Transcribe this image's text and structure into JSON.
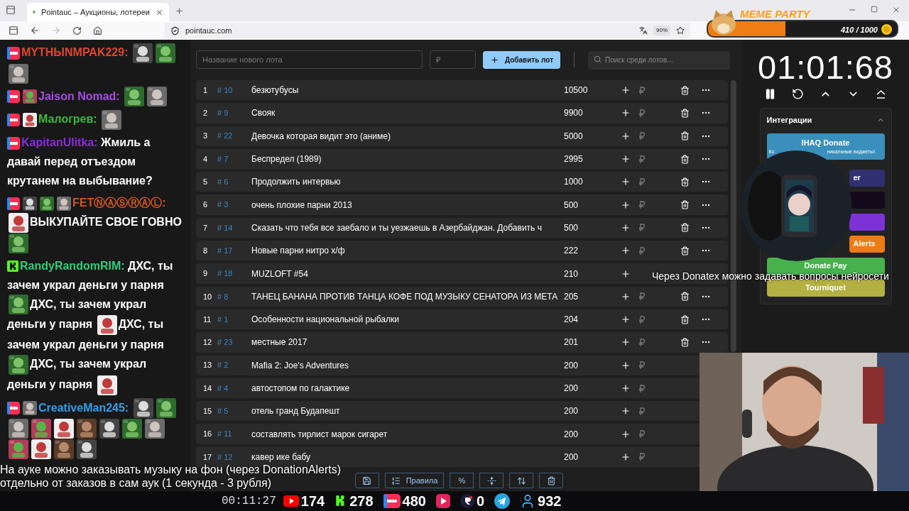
{
  "browser": {
    "tab_title": "Pointauc – Аукционы, лотереи",
    "url": "pointauc.com",
    "zoom": "90%"
  },
  "meme_widget": {
    "title": "MEME PARTY",
    "progress": "410 / 1000",
    "level": 0.41
  },
  "chat": [
    {
      "kind": "live",
      "user": "MYTHЫNMPAK229:",
      "color": "#e0452a",
      "content": [
        {
          "kind": "picture"
        },
        {
          "kind": "picture"
        },
        {
          "kind": "picture"
        }
      ]
    },
    {
      "kind": "live",
      "badges": [
        {
          "kind": "picture"
        }
      ],
      "user": "Jaison Nomad:",
      "color": "#a64de6",
      "content": [
        {
          "kind": "picture"
        },
        {
          "kind": "picture"
        }
      ]
    },
    {
      "kind": "live",
      "badges": [
        {
          "kind": "picture"
        }
      ],
      "user": "Малогрев:",
      "color": "#3cb83c",
      "content": [
        {
          "kind": "picture"
        }
      ]
    },
    {
      "kind": "live",
      "user": "KapitanUlitka:",
      "color": "#8a2be2",
      "content": [
        {
          "kind": "text",
          "text": "**Жмиль** а"
        },
        {
          "kind": "text",
          "text": "давай перед отъездом"
        },
        {
          "kind": "text",
          "text": "крутанем на выбывание?"
        }
      ]
    },
    {
      "kind": "live",
      "badges": [
        {
          "kind": "picture"
        },
        {
          "kind": "picture"
        },
        {
          "kind": "picture"
        }
      ],
      "user": "FETⓃⒶⓈⓇⒶⓁ:",
      "color": "#d2551e",
      "content": [
        {
          "kind": "picture"
        },
        {
          "kind": "text",
          "text": "ВЫКУПАЙТЕ СВОЕ"
        },
        {
          "kind": "text",
          "text": "ГОВНО"
        },
        {
          "kind": "picture"
        }
      ]
    },
    {
      "kind": "kick",
      "user": "RandyRandomRIM:",
      "color": "#2fcf7a",
      "content": [
        {
          "kind": "text",
          "text": "ДХС, ты"
        },
        {
          "kind": "text",
          "text": "зачем украл деньги у парня"
        },
        {
          "kind": "picture"
        },
        {
          "kind": "text",
          "text": "ДХС, ты зачем украл"
        },
        {
          "kind": "text",
          "text": "деньги у парня"
        },
        {
          "kind": "picture"
        },
        {
          "kind": "text",
          "text": "ДХС, ты"
        },
        {
          "kind": "text",
          "text": "зачем украл деньги у парня"
        },
        {
          "kind": "picture"
        },
        {
          "kind": "text",
          "text": "ДХС, ты зачем украл"
        },
        {
          "kind": "text",
          "text": "деньги у парня"
        },
        {
          "kind": "picture"
        }
      ]
    },
    {
      "kind": "live",
      "badges": [
        {
          "kind": "picture"
        }
      ],
      "user": "CreativeMan245:",
      "color": "#2f9ee8",
      "content": [
        {
          "kind": "picture"
        },
        {
          "kind": "picture"
        },
        {
          "kind": "picture"
        },
        {
          "kind": "picture"
        },
        {
          "kind": "picture"
        },
        {
          "kind": "picture"
        },
        {
          "kind": "picture"
        },
        {
          "kind": "picture"
        },
        {
          "kind": "picture"
        },
        {
          "kind": "picture"
        },
        {
          "kind": "picture"
        },
        {
          "kind": "picture"
        },
        {
          "kind": "picture"
        }
      ]
    }
  ],
  "auction": {
    "name_placeholder": "Название нового лота",
    "amount_placeholder": "₽",
    "add_button": "Добавить лот",
    "search_placeholder": "Поиск среди лотов...",
    "lots": [
      {
        "n": "1",
        "id": "# 10",
        "name": "безютубусы",
        "amount": "10500",
        "kind": "full"
      },
      {
        "n": "2",
        "id": "# 9",
        "name": "Свояк",
        "amount": "9900",
        "kind": "full"
      },
      {
        "n": "3",
        "id": "# 22",
        "name": "Девочка которая видит это (аниме)",
        "amount": "5000",
        "kind": "full"
      },
      {
        "n": "4",
        "id": "# 7",
        "name": "Беспредел (1989)",
        "amount": "2995",
        "kind": "full"
      },
      {
        "n": "5",
        "id": "# 6",
        "name": "Продолжить интервью",
        "amount": "1000",
        "kind": "full"
      },
      {
        "n": "6",
        "id": "# 3",
        "name": "очень плохие парни 2013",
        "amount": "500",
        "kind": "full"
      },
      {
        "n": "7",
        "id": "# 14",
        "name": "Сказать что тебя все заебало и ты уезжаешь в Азербайджан. Добавить ч",
        "amount": "500",
        "kind": "full"
      },
      {
        "n": "8",
        "id": "# 17",
        "name": "Новые парни нитро х/ф",
        "amount": "222",
        "kind": "full"
      },
      {
        "n": "9",
        "id": "# 18",
        "name": "MUZLOFT #54",
        "amount": "210",
        "kind": "covered"
      },
      {
        "n": "10",
        "id": "# 8",
        "name": "ТАНЕЦ БАНАНА ПРОТИВ ТАНЦА КОФЕ ПОД МУЗЫКУ СЕНАТОРА ИЗ МЕТА",
        "amount": "205",
        "kind": "full"
      },
      {
        "n": "11",
        "id": "# 1",
        "name": "Особенности национальной рыбалки",
        "amount": "204",
        "kind": "full"
      },
      {
        "n": "12",
        "id": "# 23",
        "name": "местные 2017",
        "amount": "201",
        "kind": "full"
      },
      {
        "n": "13",
        "id": "# 2",
        "name": "Mafia 2: Joe's Adventures",
        "amount": "200",
        "kind": "clipped"
      },
      {
        "n": "14",
        "id": "# 4",
        "name": "автостопом по галактике",
        "amount": "200",
        "kind": "clipped"
      },
      {
        "n": "15",
        "id": "# 5",
        "name": "отель гранд Будапешт",
        "amount": "200",
        "kind": "clipped"
      },
      {
        "n": "16",
        "id": "# 11",
        "name": "составлять тирлист марок сигарет",
        "amount": "200",
        "kind": "clipped"
      },
      {
        "n": "17",
        "id": "# 12",
        "name": "кавер ике бабу",
        "amount": "200",
        "kind": "clipped"
      }
    ],
    "toolbar": [
      {
        "kind": "save"
      },
      {
        "kind": "rules",
        "label": "Правила"
      },
      {
        "kind": "text",
        "label": "%"
      },
      {
        "kind": "split"
      },
      {
        "kind": "sort"
      },
      {
        "kind": "trash"
      }
    ]
  },
  "timer": {
    "time": "01:01:68"
  },
  "integrations": {
    "title": "Интеграции",
    "expanded": true,
    "buttons": [
      {
        "kind": "full",
        "label": "IHAQ Donate",
        "subtitle_parts": [
          "Ко",
          "никальные виджеты!"
        ],
        "color": "#3b8fbd"
      },
      {
        "kind": "covered",
        "label": "er",
        "color": "#2f2f72"
      },
      {
        "kind": "covered",
        "color": "#150a1c"
      },
      {
        "kind": "covered",
        "color": "#7d32d6"
      },
      {
        "kind": "covered",
        "label": "Alerts",
        "color": "#ef7b13"
      },
      {
        "kind": "full",
        "label": "Donate Pay",
        "color": "#47b14b"
      },
      {
        "kind": "full",
        "label": "Tourniquet",
        "color": "#b4b043"
      }
    ]
  },
  "subtitles": {
    "bottom": [
      "На ауке можно заказывать музыку на фон (через DonationAlerts)",
      "отдельно от заказов в сам аук (1 секунда - 3 рубля)"
    ],
    "right": "Через Donatex можно задавать вопросы нейросети"
  },
  "stream_bar": {
    "uptime": "00:11:27",
    "stats": [
      {
        "kind": "youtube",
        "count": "174"
      },
      {
        "kind": "kick",
        "count": "278"
      },
      {
        "kind": "live",
        "count": "480"
      },
      {
        "kind": "play"
      },
      {
        "kind": "r",
        "count": "0"
      },
      {
        "kind": "telegram"
      },
      {
        "kind": "viewers",
        "count": "932"
      }
    ]
  }
}
